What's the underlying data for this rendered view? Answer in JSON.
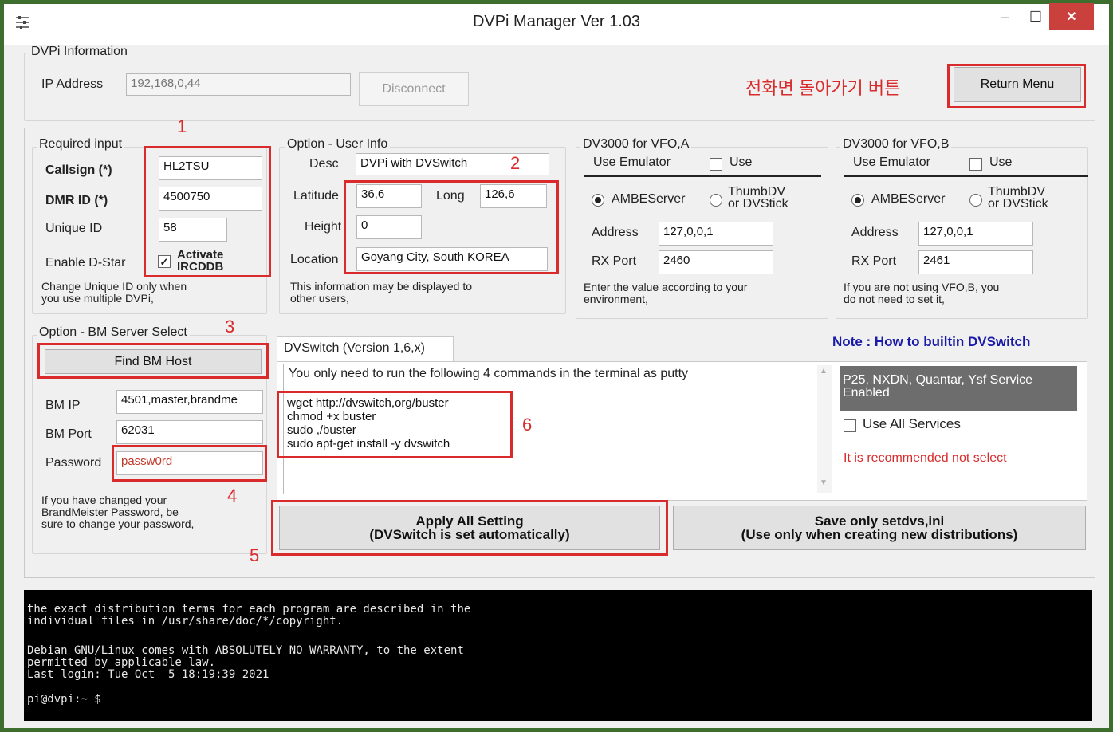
{
  "window": {
    "title": "DVPi Manager Ver 1.03",
    "minimize_glyph": "–",
    "maximize_glyph": "☐",
    "close_glyph": "✕",
    "app_icon": "settings-sliders-icon"
  },
  "dvpi_info": {
    "group_label": "DVPi Information",
    "ip_label": "IP Address",
    "ip_value": "192,168,0,44",
    "disconnect_label": "Disconnect",
    "annotation_text": "전화면 돌아가기 버튼",
    "return_label": "Return Menu"
  },
  "required": {
    "group_label": "Required input",
    "callsign_label": "Callsign (*)",
    "callsign_value": "HL2TSU",
    "dmr_label": "DMR ID (*)",
    "dmr_value": "4500750",
    "unique_label": "Unique ID",
    "unique_value": "58",
    "dstar_label": "Enable D-Star",
    "activate_line1": "Activate",
    "activate_line2": "IRCDDB",
    "activate_checked": "✓",
    "note_line1": "Change Unique ID only when",
    "note_line2": "you use multiple DVPi,",
    "marker": "1"
  },
  "user_info": {
    "group_label": "Option - User Info",
    "desc_label": "Desc",
    "desc_value": "DVPi with DVSwitch",
    "lat_label": "Latitude",
    "lat_value": "36,6",
    "long_label": "Long",
    "long_value": "126,6",
    "height_label": "Height",
    "height_value": "0",
    "location_label": "Location",
    "location_value": "Goyang City, South KOREA",
    "note_line1": "This information may be displayed to",
    "note_line2": "other users,",
    "marker": "2"
  },
  "vfo_a": {
    "group_label": "DV3000 for VFO,A",
    "emulator_label": "Use Emulator",
    "use_label": "Use",
    "ambe_label": "AMBEServer",
    "thumb_line1": "ThumbDV",
    "thumb_line2": "or DVStick",
    "address_label": "Address",
    "address_value": "127,0,0,1",
    "rxport_label": "RX Port",
    "rxport_value": "2460",
    "note_line1": "Enter the value according to your",
    "note_line2": "environment,"
  },
  "vfo_b": {
    "group_label": "DV3000 for VFO,B",
    "emulator_label": "Use Emulator",
    "use_label": "Use",
    "ambe_label": "AMBEServer",
    "thumb_line1": "ThumbDV",
    "thumb_line2": "or DVStick",
    "address_label": "Address",
    "address_value": "127,0,0,1",
    "rxport_label": "RX Port",
    "rxport_value": "2461",
    "note_line1": "If you are not using VFO,B, you",
    "note_line2": "do not need to set it,"
  },
  "bm": {
    "group_label": "Option - BM Server Select",
    "find_label": "Find BM Host",
    "ip_label": "BM IP",
    "ip_value": "4501,master,brandme",
    "port_label": "BM Port",
    "port_value": "62031",
    "password_label": "Password",
    "password_value": "passw0rd",
    "note_line1": "If you have changed your",
    "note_line2": "BrandMeister Password, be",
    "note_line3": "sure to change your password,",
    "marker3": "3",
    "marker4": "4"
  },
  "dvswitch": {
    "tab_label": "DVSwitch (Version 1,6,x)",
    "intro": "You only need to run the following 4 commands in the terminal as putty",
    "cmd1": "wget http://dvswitch,org/buster",
    "cmd2": "chmod +x buster",
    "cmd3": "sudo ,/buster",
    "cmd4": "sudo apt-get install -y dvswitch",
    "marker": "6"
  },
  "services": {
    "note_title": "Note : How to builtin DVSwitch",
    "enabled_line1": "P25, NXDN, Quantar, Ysf Service",
    "enabled_line2": "Enabled",
    "use_all_label": "Use All Services",
    "recommend": "It is recommended not select"
  },
  "actions": {
    "apply_line1": "Apply All Setting",
    "apply_line2": "(DVSwitch is set automatically)",
    "save_line1": "Save only setdvs,ini",
    "save_line2": "(Use only when creating new distributions)",
    "marker": "5"
  },
  "terminal": {
    "line1": "the exact distribution terms for each program are described in the",
    "line2": "individual files in /usr/share/doc/*/copyright.",
    "line3": "Debian GNU/Linux comes with ABSOLUTELY NO WARRANTY, to the extent",
    "line4": "permitted by applicable law.",
    "line5": "Last login: Tue Oct  5 18:19:39 2021",
    "prompt": "pi@dvpi:~ $"
  },
  "colors": {
    "annotation_red": "#d92b2b",
    "note_blue": "#1a1aa8",
    "frame_green": "#3d6e2e",
    "services_gray": "#6d6d6d"
  }
}
